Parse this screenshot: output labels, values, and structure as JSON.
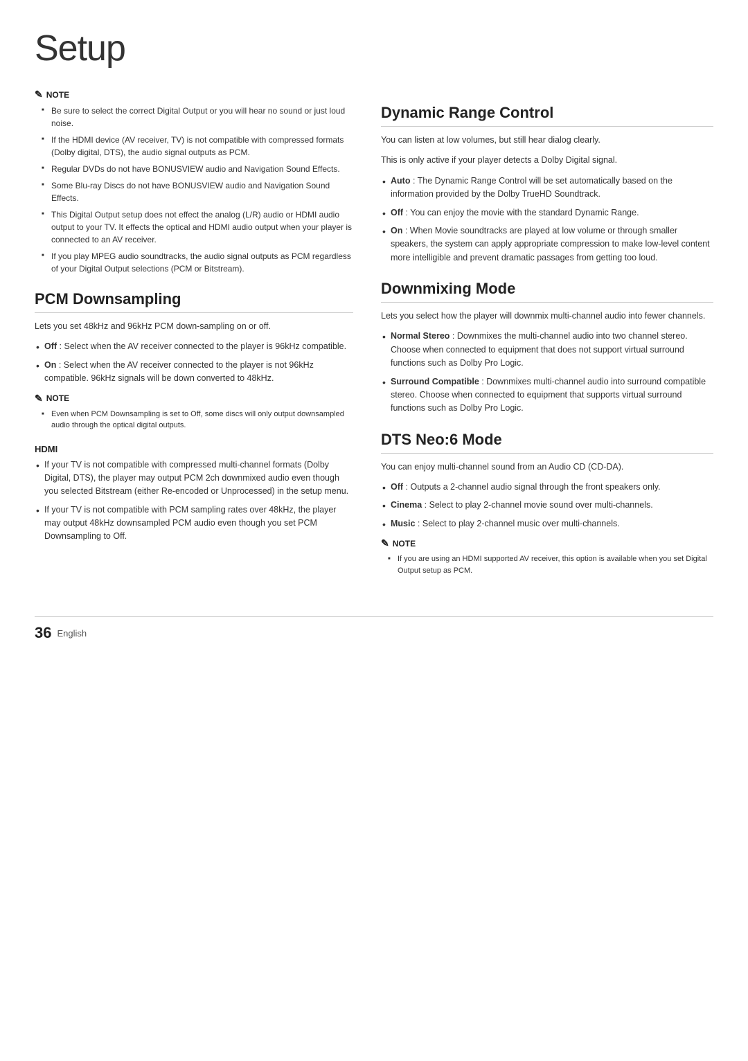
{
  "page": {
    "title": "Setup",
    "footer_number": "36",
    "footer_lang": "English"
  },
  "left_col": {
    "top_note": {
      "label": "NOTE",
      "items": [
        "Be sure to select the correct Digital Output or you will hear no sound or just loud noise.",
        "If the HDMI device (AV receiver, TV) is not compatible with compressed formats (Dolby digital, DTS), the audio signal outputs as PCM.",
        "Regular DVDs do not have BONUSVIEW audio and Navigation Sound Effects.",
        "Some Blu-ray Discs do not have BONUSVIEW audio and Navigation Sound Effects.",
        "This Digital Output setup does not effect the analog (L/R) audio or HDMI audio output to your TV. It effects the optical and HDMI audio output when your player is connected to an AV receiver.",
        "If you play MPEG audio soundtracks, the audio signal outputs as PCM regardless of your Digital Output selections (PCM or Bitstream)."
      ]
    },
    "pcm_section": {
      "heading": "PCM Downsampling",
      "desc": "Lets you set 48kHz and 96kHz PCM down-sampling on or off.",
      "bullets": [
        {
          "bold": "Off",
          "text": " : Select when the AV receiver connected to the player is 96kHz compatible."
        },
        {
          "bold": "On",
          "text": " : Select when the AV receiver connected to the player is not 96kHz compatible. 96kHz signals will be down converted to 48kHz."
        }
      ],
      "note": {
        "label": "NOTE",
        "items": [
          "Even when PCM Downsampling is set to Off, some discs will only output downsampled audio through the optical digital outputs."
        ]
      },
      "hdmi": {
        "label": "HDMI",
        "bullets": [
          "If your TV is not compatible with compressed multi-channel formats (Dolby Digital, DTS), the player may output PCM 2ch downmixed audio even though you selected Bitstream (either Re-encoded or Unprocessed) in the setup menu.",
          "If your TV is not compatible with PCM sampling rates over 48kHz, the player may output 48kHz downsampled PCM audio even though you set PCM Downsampling to Off."
        ]
      }
    }
  },
  "right_col": {
    "dynamic_range": {
      "heading": "Dynamic Range Control",
      "desc1": "You can listen at low volumes, but still hear dialog clearly.",
      "desc2": "This is only active if your player detects a Dolby Digital signal.",
      "bullets": [
        {
          "bold": "Auto",
          "text": " : The Dynamic Range Control will be set automatically based on the information provided by the Dolby TrueHD Soundtrack."
        },
        {
          "bold": "Off",
          "text": " : You can enjoy the movie with the standard Dynamic Range."
        },
        {
          "bold": "On",
          "text": " : When Movie soundtracks are played at low volume or through smaller speakers, the system can apply appropriate compression to make low-level content more intelligible and prevent dramatic passages from getting too loud."
        }
      ]
    },
    "downmixing": {
      "heading": "Downmixing Mode",
      "desc": "Lets you select how the player will downmix multi-channel audio into fewer channels.",
      "bullets": [
        {
          "bold": "Normal Stereo",
          "text": " : Downmixes the multi-channel audio into two channel stereo. Choose when connected to equipment that does not support virtual surround functions such as Dolby Pro Logic."
        },
        {
          "bold": "Surround Compatible",
          "text": " : Downmixes multi-channel audio into surround compatible stereo. Choose when connected to equipment that supports virtual surround functions such as Dolby Pro Logic."
        }
      ]
    },
    "dts_neo": {
      "heading": "DTS Neo:6 Mode",
      "desc": "You can enjoy multi-channel sound from an Audio CD (CD-DA).",
      "bullets": [
        {
          "bold": "Off",
          "text": " : Outputs a 2-channel audio signal through the front speakers only."
        },
        {
          "bold": "Cinema",
          "text": " : Select to play 2-channel movie sound over multi-channels."
        },
        {
          "bold": "Music",
          "text": " : Select to play 2-channel music over multi-channels."
        }
      ],
      "note": {
        "label": "NOTE",
        "items": [
          "If you are using an HDMI supported AV receiver, this option is available when you set Digital Output setup as PCM."
        ]
      }
    }
  }
}
